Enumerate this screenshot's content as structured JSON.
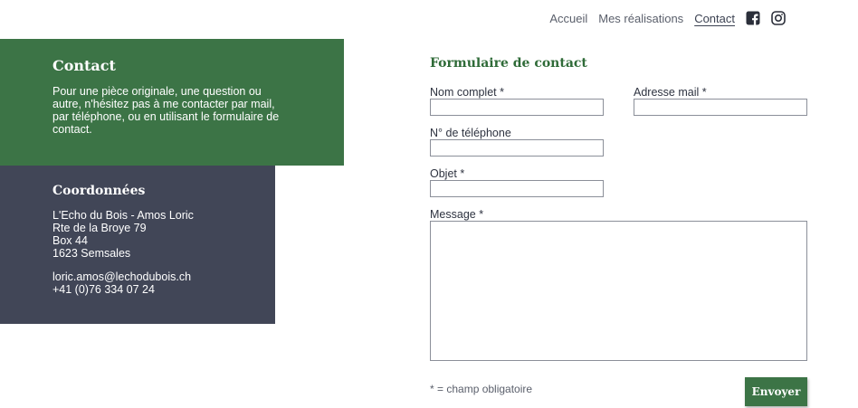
{
  "nav": {
    "items": [
      {
        "label": "Accueil"
      },
      {
        "label": "Mes réalisations"
      },
      {
        "label": "Contact",
        "active": true
      }
    ],
    "social": [
      "facebook-icon",
      "instagram-icon"
    ]
  },
  "intro": {
    "title": "Contact",
    "text": "Pour une pièce originale, une question ou autre, n'hésitez pas à me contacter par mail, par téléphone, ou en utilisant le formulaire de contact."
  },
  "coords": {
    "title": "Coordonnées",
    "lines": [
      "L'Echo du Bois - Amos Loric",
      "Rte de la Broye 79",
      "Box 44",
      "1623 Semsales"
    ],
    "email": "loric.amos@lechodubois.ch",
    "phone": "+41 (0)76 334 07 24"
  },
  "form": {
    "title": "Formulaire de contact",
    "fields": {
      "name": {
        "label": "Nom complet *",
        "value": ""
      },
      "email": {
        "label": "Adresse mail *",
        "value": ""
      },
      "phone": {
        "label": "N° de téléphone",
        "value": ""
      },
      "subject": {
        "label": "Objet *",
        "value": ""
      },
      "message": {
        "label": "Message *",
        "value": ""
      }
    },
    "required_note": "* = champ obligatoire",
    "submit_label": "Envoyer"
  },
  "colors": {
    "green": "#3c7446",
    "dark": "#414657",
    "title_green": "#2f6b38"
  }
}
